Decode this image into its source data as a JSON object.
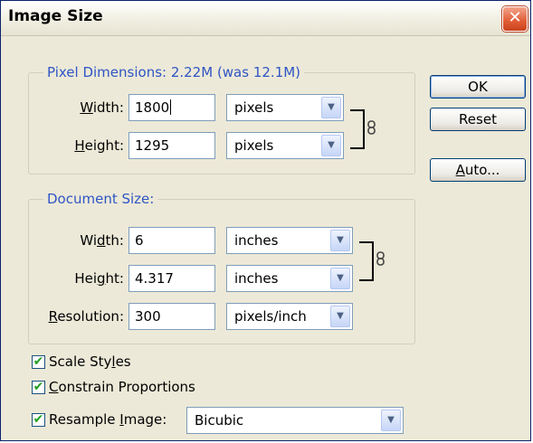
{
  "window": {
    "title": "Image Size",
    "close_glyph": "✕"
  },
  "pixel_dimensions": {
    "legend": "Pixel Dimensions:  2.22M (was 12.1M)",
    "width": {
      "label_pre": "",
      "label_u": "W",
      "label_post": "idth:",
      "value": "1800",
      "unit": "pixels"
    },
    "height": {
      "label_pre": "",
      "label_u": "H",
      "label_post": "eight:",
      "value": "1295",
      "unit": "pixels"
    }
  },
  "document_size": {
    "legend": "Document Size:",
    "width": {
      "label_pre": "Wi",
      "label_u": "d",
      "label_post": "th:",
      "value": "6",
      "unit": "inches"
    },
    "height": {
      "label_pre": "Hei",
      "label_u": "g",
      "label_post": "ht:",
      "value": "4.317",
      "unit": "inches"
    },
    "resolution": {
      "label_pre": "",
      "label_u": "R",
      "label_post": "esolution:",
      "value": "300",
      "unit": "pixels/inch"
    }
  },
  "buttons": {
    "ok": "OK",
    "reset": "Reset",
    "auto_u": "A",
    "auto_post": "uto..."
  },
  "options": {
    "scale_styles": {
      "pre": "Scale Sty",
      "u": "l",
      "post": "es",
      "checked": true
    },
    "constrain": {
      "pre": "",
      "u": "C",
      "post": "onstrain Proportions",
      "checked": true
    },
    "resample": {
      "pre": "Resample ",
      "u": "I",
      "post": "mage:",
      "checked": true,
      "method": "Bicubic"
    }
  },
  "icons": {
    "dropdown": "chevron-down-icon",
    "link": "chain-link-icon",
    "checkmark": "checkmark-icon"
  },
  "colors": {
    "legend_blue": "#2f55c4",
    "dialog_bg": "#ece9d8",
    "field_border": "#7f9db9",
    "check_green": "#21a121"
  }
}
